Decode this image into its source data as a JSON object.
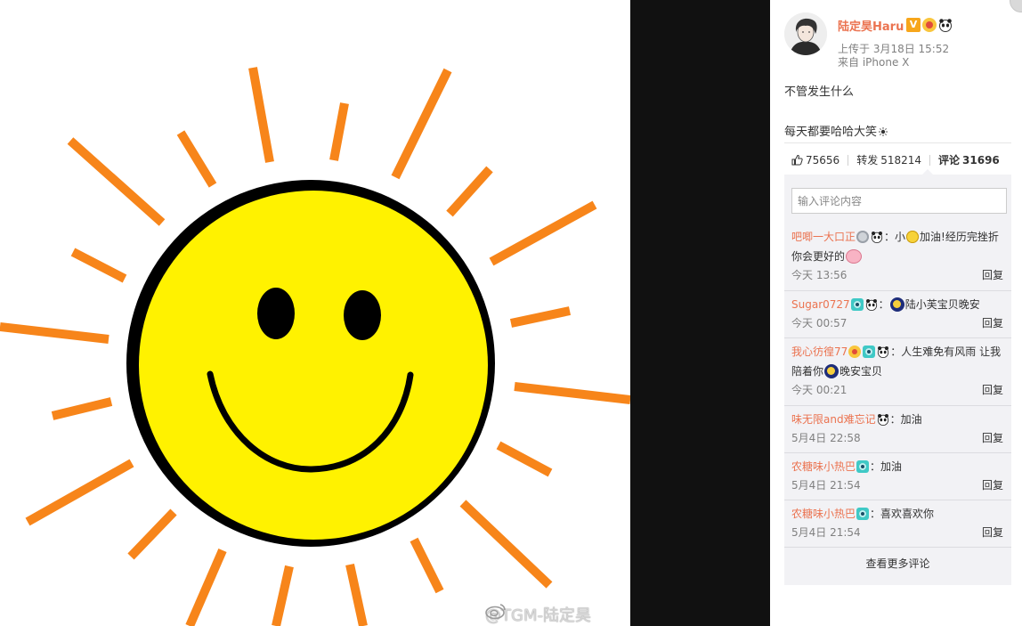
{
  "photo": {
    "watermark": "@TGM-陆定昊",
    "colors": {
      "ray": "#f7851a",
      "face": "#fff200",
      "outline": "#000000",
      "background": "#ffffff"
    }
  },
  "post": {
    "author": "陆定昊Haru",
    "badges": [
      "verified-v-icon",
      "level-badge-icon",
      "panda-icon"
    ],
    "upload_time": "上传于 3月18日 15:52",
    "source": "来自 iPhone X",
    "text_line1": "不管发生什么",
    "text_line2": "每天都要哈哈大笑"
  },
  "stats": {
    "likes": "75656",
    "repost_label": "转发",
    "reposts": "518214",
    "comment_label": "评论",
    "comments": "31696"
  },
  "comment_input": {
    "placeholder": "输入评论内容"
  },
  "reply_label": "回复",
  "comments": [
    {
      "author": "吧唧一大口正",
      "text_before": "：小",
      "text_after": "加油!经历完挫折你会更好的",
      "time": "今天 13:56"
    },
    {
      "author": "Sugar0727",
      "text_before": "：",
      "text_after": "陆小芙宝贝晚安",
      "time": "今天 00:57"
    },
    {
      "author": "我心彷徨77",
      "text_before": "：人生难免有风雨 让我陪着你",
      "text_after": "晚安宝贝",
      "time": "今天 00:21"
    },
    {
      "author": "味无限and难忘记",
      "text_before": "：加油",
      "time": "5月4日 22:58"
    },
    {
      "author": "农糖味小热巴",
      "text_before": "：加油",
      "time": "5月4日 21:54"
    },
    {
      "author": "农糖味小热巴",
      "text_before": "：喜欢喜欢你",
      "time": "5月4日 21:54"
    }
  ],
  "more_comments": "查看更多评论",
  "colors": {
    "author": "#eb7350",
    "panel_bg": "#f2f2f5",
    "viewer_bg": "#111111"
  }
}
